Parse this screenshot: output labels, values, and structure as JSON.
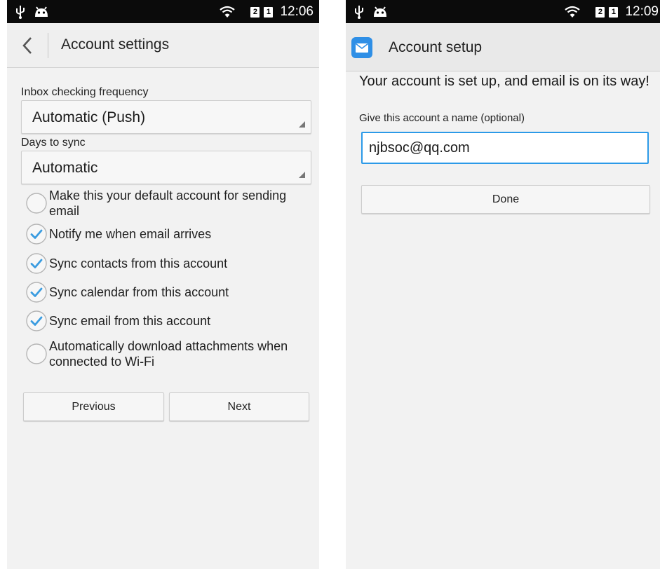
{
  "left_screen": {
    "status": {
      "time": "12:06",
      "sim1": "2",
      "sim2": "1"
    },
    "title": "Account settings",
    "inbox_label": "Inbox checking frequency",
    "inbox_value": "Automatic (Push)",
    "days_label": "Days to sync",
    "days_value": "Automatic",
    "options": [
      {
        "label": "Make this your default account for sending email",
        "checked": false
      },
      {
        "label": "Notify me when email arrives",
        "checked": true
      },
      {
        "label": "Sync contacts from this account",
        "checked": true
      },
      {
        "label": "Sync calendar from this account",
        "checked": true
      },
      {
        "label": "Sync email from this account",
        "checked": true
      },
      {
        "label": "Automatically download attachments when connected to Wi-Fi",
        "checked": false
      }
    ],
    "previous_label": "Previous",
    "next_label": "Next"
  },
  "right_screen": {
    "status": {
      "time": "12:09",
      "sim1": "2",
      "sim2": "1"
    },
    "title": "Account setup",
    "headline": "Your account is set up, and email is on its way!",
    "name_label": "Give this account a name (optional)",
    "name_value": "njbsoc@qq.com",
    "done_label": "Done"
  },
  "colors": {
    "accent": "#2c9ae8",
    "check": "#3a9ce0",
    "statusbar": "#0b0b0b"
  }
}
